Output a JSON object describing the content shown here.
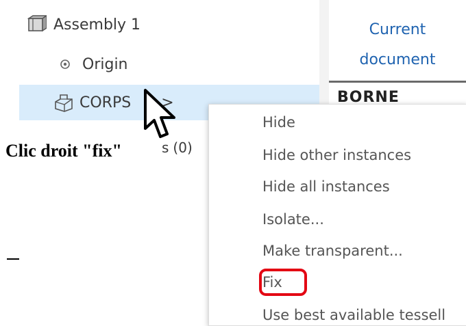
{
  "tree": {
    "assembly_label": "Assembly 1",
    "origin_label": "Origin",
    "corps_label": "CORPS",
    "corps_suffix": ">",
    "parts_prefix": "s",
    "parts_count": "(0)"
  },
  "right_panel": {
    "tab_line1": "Current",
    "tab_line2": "document",
    "item_partial": "BORNE"
  },
  "context_menu": {
    "items": [
      "Hide",
      "Hide other instances",
      "Hide all instances",
      "Isolate...",
      "Make transparent...",
      "Fix",
      "Use best available tessell"
    ]
  },
  "annotation": {
    "text": "Clic droit \"fix\"",
    "dash": "_"
  },
  "colors": {
    "selection": "#d9ecfb",
    "link": "#1f63b0",
    "highlight": "#e30613"
  },
  "icons": {
    "assembly": "assembly-icon",
    "origin": "origin-icon",
    "part": "part-instance-icon",
    "cursor": "mouse-cursor-icon"
  }
}
